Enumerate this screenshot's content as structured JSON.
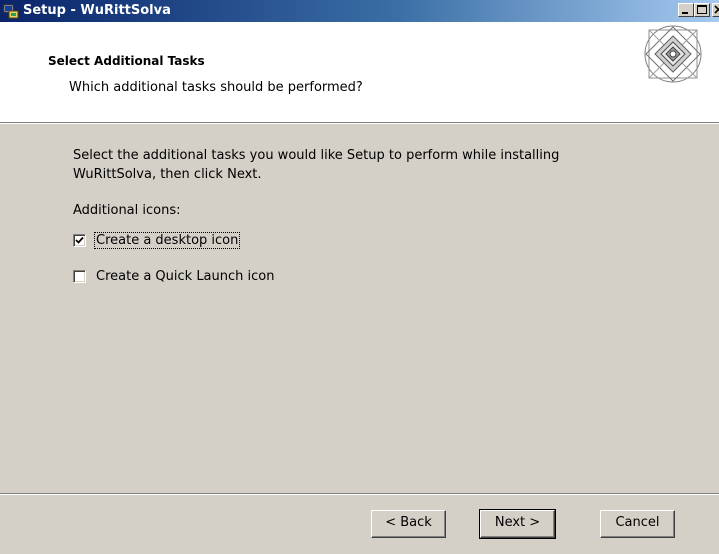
{
  "window": {
    "title": "Setup - WuRittSolva",
    "controls": [
      "minimize-icon",
      "maximize-icon",
      "close-icon"
    ]
  },
  "header": {
    "title": "Select Additional Tasks",
    "subtitle": "Which additional tasks should be performed?",
    "logo": "wizard-diamond-logo"
  },
  "body": {
    "intro_line1": "Select the additional tasks you would like Setup to perform while installing",
    "intro_line2": "WuRittSolva, then click Next.",
    "group_label": "Additional icons:",
    "tasks": [
      {
        "label": "Create a desktop icon",
        "checked": true
      },
      {
        "label": "Create a Quick Launch icon",
        "checked": false
      }
    ]
  },
  "buttons": {
    "back": "< Back",
    "next": "Next >",
    "cancel": "Cancel"
  },
  "colors": {
    "titlebar_start": "#0a246a",
    "titlebar_end": "#a6caf0",
    "face": "#d4d0c8",
    "header_bg": "#ffffff"
  }
}
